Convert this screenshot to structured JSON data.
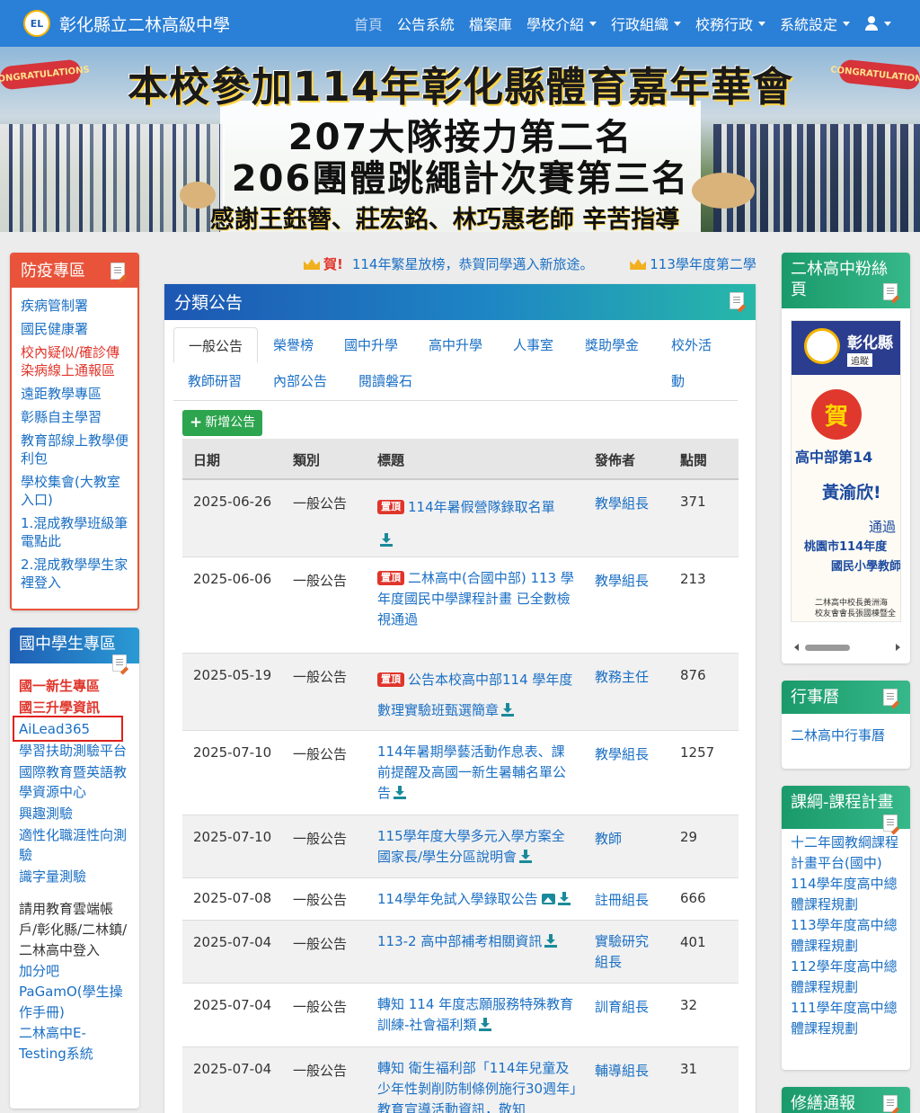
{
  "navbar": {
    "brand": "彰化縣立二林高級中學",
    "items": [
      {
        "label": "首頁",
        "dropdown": false,
        "active": true
      },
      {
        "label": "公告系統",
        "dropdown": false
      },
      {
        "label": "檔案庫",
        "dropdown": false
      },
      {
        "label": "學校介紹",
        "dropdown": true
      },
      {
        "label": "行政組織",
        "dropdown": true
      },
      {
        "label": "校務行政",
        "dropdown": true
      },
      {
        "label": "系統設定",
        "dropdown": true
      }
    ],
    "user_icon": "user-icon"
  },
  "banner": {
    "title": "本校參加114年彰化縣體育嘉年華會",
    "line1": "207大隊接力第二名",
    "line2": "206團體跳繩計次賽第三名",
    "thanks": "感謝王鈺簪、莊宏銘、林巧惠老師 辛苦指導",
    "badge": "CONGRATULATIONS"
  },
  "left_panel_1": {
    "title": "防疫專區",
    "items": [
      {
        "label": "疾病管制署"
      },
      {
        "label": "國民健康署"
      },
      {
        "label": "校內疑似/確診傳染病線上通報區",
        "red": true
      },
      {
        "label": "遠距教學專區"
      },
      {
        "label": "彰縣自主學習"
      },
      {
        "label": "教育部線上教學便利包"
      },
      {
        "label": "學校集會(大教室入口)"
      },
      {
        "label": "1.混成教學班級筆電點此"
      },
      {
        "label": "2.混成教學學生家裡登入"
      }
    ]
  },
  "left_panel_2": {
    "title": "國中學生專區",
    "items": [
      {
        "label": "國一新生專區",
        "style": "bold-red"
      },
      {
        "label": "國三升學資訊",
        "style": "bold-red"
      },
      {
        "label": "AiLead365",
        "style": "link"
      },
      {
        "label": "學習扶助測驗平台",
        "style": "link"
      },
      {
        "label": "國際教育暨英語教學資源中心",
        "style": "link"
      },
      {
        "label": "興趣測驗",
        "style": "link"
      },
      {
        "label": "適性化職涯性向測驗",
        "style": "link"
      },
      {
        "label": "識字量測驗",
        "style": "link"
      }
    ],
    "note": "請用教育雲端帳戶/彰化縣/二林鎮/二林高中登入",
    "extra_links": [
      "加分吧",
      "PaGamO(學生操作手冊)",
      "二林高中E-Testing系統"
    ]
  },
  "marquee": {
    "items": [
      {
        "prefix": "賀!",
        "text": "114年繁星放榜，恭賀同學邁入新旅途。"
      },
      {
        "prefix": "",
        "text": "113學年度第二學"
      }
    ]
  },
  "main": {
    "title": "分類公告",
    "tabs": [
      "一般公告",
      "榮譽榜",
      "國中升學",
      "高中升學",
      "人事室",
      "獎助學金",
      "校外活動",
      "教師研習",
      "內部公告",
      "閱讀磐石"
    ],
    "active_tab": "一般公告",
    "add_button": "新增公告",
    "columns": [
      "日期",
      "類別",
      "標題",
      "發佈者",
      "點閱"
    ],
    "pin_label": "置頂",
    "rows": [
      {
        "date": "2025-06-26",
        "category": "一般公告",
        "pinned": true,
        "title": "114年暑假營隊錄取名單",
        "publisher": "教學組長",
        "views": "371",
        "download": true
      },
      {
        "date": "2025-06-06",
        "category": "一般公告",
        "pinned": true,
        "title": "二林高中(合國中部) 113 學年度國民中學課程計畫 已全數檢視通過",
        "publisher": "教學組長",
        "views": "213",
        "download": false
      },
      {
        "date": "2025-05-19",
        "category": "一般公告",
        "pinned": true,
        "title": "公告本校高中部114 學年度數理實驗班甄選簡章",
        "publisher": "教務主任",
        "views": "876",
        "download": true
      },
      {
        "date": "2025-07-10",
        "category": "一般公告",
        "pinned": false,
        "title": "114年暑期學藝活動作息表、課前提醒及高國一新生暑輔名單公告",
        "publisher": "教學組長",
        "views": "1257",
        "download": true
      },
      {
        "date": "2025-07-10",
        "category": "一般公告",
        "pinned": false,
        "title": "115學年度大學多元入學方案全國家長/學生分區說明會",
        "publisher": "教師",
        "views": "29",
        "download": true
      },
      {
        "date": "2025-07-08",
        "category": "一般公告",
        "pinned": false,
        "title": "114學年免試入學錄取公告",
        "publisher": "註冊組長",
        "views": "666",
        "download": true,
        "image": true
      },
      {
        "date": "2025-07-04",
        "category": "一般公告",
        "pinned": false,
        "title": "113-2 高中部補考相關資訊",
        "publisher": "實驗研究組長",
        "views": "401",
        "download": true
      },
      {
        "date": "2025-07-04",
        "category": "一般公告",
        "pinned": false,
        "title": "轉知 114 年度志願服務特殊教育訓練-社會福利類",
        "publisher": "訓育組長",
        "views": "32",
        "download": true
      },
      {
        "date": "2025-07-04",
        "category": "一般公告",
        "pinned": false,
        "title": "轉知 衛生福利部「114年兒童及少年性剝削防制條例施行30週年」教育宣導活動資訊，敬知",
        "publisher": "輔導組長",
        "views": "31",
        "download": false
      }
    ]
  },
  "right_panel_fb": {
    "title": "二林高中粉絲頁",
    "image_text": {
      "name": "彰化縣",
      "follow": "追蹤",
      "he": "賀",
      "line1": "高中部第14",
      "line2": "黃渝欣!",
      "line3": "通過",
      "line4": "桃園市114年度",
      "line5": "國民小學教師",
      "line6": "二林高中校長黃洲海",
      "line7": "校友會會長張國棟暨全"
    }
  },
  "right_panel_cal": {
    "title": "行事曆",
    "items": [
      "二林高中行事曆"
    ]
  },
  "right_panel_curr": {
    "title": "課綱-課程計畫",
    "items": [
      "十二年國教綱課程計畫平台(國中)",
      "114學年度高中總體課程規劃",
      "113學年度高中總體課程規劃",
      "112學年度高中總體課程規劃",
      "111學年度高中總體課程規劃"
    ]
  },
  "right_panel_rep": {
    "title": "修繕通報"
  },
  "colors": {
    "navbar": "#2a7fd6",
    "red_panel": "#e8533a",
    "green_panel": "#1a9a6a",
    "link": "#1a6fc4",
    "add_button": "#2da44e",
    "pin": "#e0352b"
  }
}
